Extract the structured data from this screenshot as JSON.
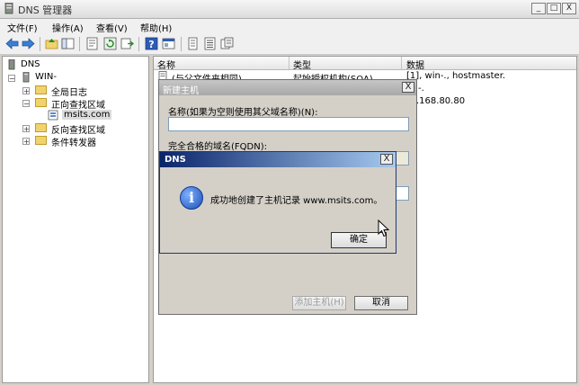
{
  "window": {
    "title": "DNS 管理器",
    "controls": {
      "minimize": "_",
      "restore": "□",
      "close": "X"
    }
  },
  "menu": [
    "文件(F)",
    "操作(A)",
    "查看(V)",
    "帮助(H)"
  ],
  "toolbar_icons": [
    "back-arrow-icon",
    "forward-arrow-icon",
    "up-folder-icon",
    "console-tree-icon",
    "properties-icon",
    "refresh-icon",
    "export-icon",
    "help-icon",
    "console-icon",
    "list-icon",
    "list-detail-icon",
    "filter-icon"
  ],
  "tree": {
    "root": "DNS",
    "server": "WIN-",
    "items": [
      {
        "label": "全局日志",
        "expander": "+"
      },
      {
        "label": "正向查找区域",
        "expander": "−"
      },
      {
        "label": "msits.com",
        "expander": ""
      },
      {
        "label": "反向查找区域",
        "expander": "+"
      },
      {
        "label": "条件转发器",
        "expander": "+"
      }
    ]
  },
  "list": {
    "columns": [
      "名称",
      "类型",
      "数据"
    ],
    "rows": [
      {
        "name": "(与父文件夹相同)",
        "type": "起始授权机构(SOA)",
        "data": "[1], win-., hostmaster."
      },
      {
        "name": "",
        "type": "",
        "data": "-."
      },
      {
        "name": "",
        "type": "",
        "data": ".168.80.80"
      }
    ]
  },
  "new_host_dialog": {
    "title": "新建主机",
    "name_label": "名称(如果为空则使用其父域名称)(N):",
    "name_value": "",
    "fqdn_label": "完全合格的域名(FQDN):",
    "fqdn_value": "",
    "add_button": "添加主机(H)",
    "cancel_button": "取消",
    "close": "X"
  },
  "message_box": {
    "title": "DNS",
    "message": "成功地创建了主机记录 www.msits.com。",
    "ok_button": "确定",
    "close": "X"
  },
  "colors": {
    "title_active": "#0a246a",
    "title_active_end": "#a6caf0",
    "dialog_face": "#d4d0c8",
    "folder": "#f1d36d"
  }
}
